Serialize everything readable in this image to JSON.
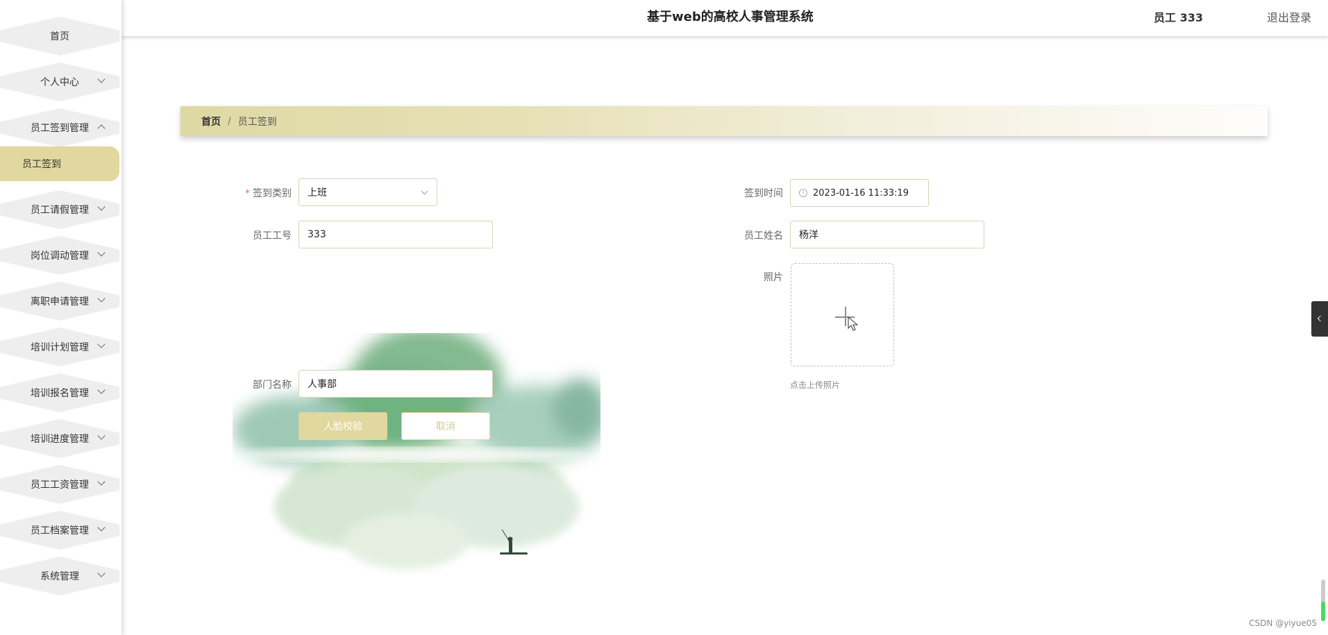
{
  "header": {
    "title": "基于web的高校人事管理系统",
    "user": "员工 333",
    "logout": "退出登录"
  },
  "sidebar": {
    "items": [
      {
        "label": "首页",
        "expandable": false
      },
      {
        "label": "个人中心",
        "expandable": true
      },
      {
        "label": "员工签到管理",
        "expandable": true,
        "expanded": true
      },
      {
        "label": "员工请假管理",
        "expandable": true
      },
      {
        "label": "岗位调动管理",
        "expandable": true
      },
      {
        "label": "离职申请管理",
        "expandable": true
      },
      {
        "label": "培训计划管理",
        "expandable": true
      },
      {
        "label": "培训报名管理",
        "expandable": true
      },
      {
        "label": "培训进度管理",
        "expandable": true
      },
      {
        "label": "员工工资管理",
        "expandable": true
      },
      {
        "label": "员工档案管理",
        "expandable": true
      },
      {
        "label": "系统管理",
        "expandable": true
      }
    ],
    "active_sub": "员工签到"
  },
  "breadcrumb": {
    "home": "首页",
    "separator": "/",
    "current": "员工签到"
  },
  "form": {
    "sign_type": {
      "label": "签到类别",
      "value": "上班"
    },
    "sign_time": {
      "label": "签到时间",
      "value": "2023-01-16 11:33:19"
    },
    "employee_no": {
      "label": "员工工号",
      "value": "333"
    },
    "employee_name": {
      "label": "员工姓名",
      "value": "杨洋"
    },
    "photo": {
      "label": "照片",
      "hint": "点击上传照片"
    },
    "department": {
      "label": "部门名称",
      "value": "人事部"
    },
    "face_verify_button": "人脸校验",
    "cancel_button": "取消"
  },
  "watermark": "CSDN @yiyue05",
  "colors": {
    "accent": "#e0d89f",
    "menu_bg": "#eeeeef",
    "required": "#f56c6c"
  }
}
